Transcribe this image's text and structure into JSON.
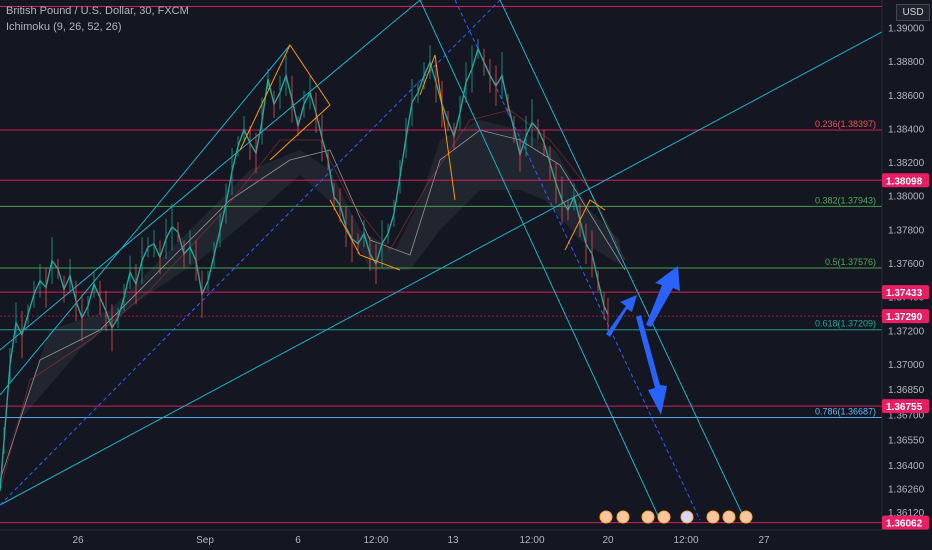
{
  "header": {
    "symbol": "British Pound / U.S. Dollar, 30, FXCM",
    "indicator": "Ichimoku (9, 26, 52, 26)",
    "currency": "USD"
  },
  "chart_data": {
    "type": "candlestick",
    "ylim": [
      1.3603,
      1.3917
    ],
    "y_ticks": [
      1.3612,
      1.3626,
      1.364,
      1.3655,
      1.367,
      1.3685,
      1.37,
      1.372,
      1.374,
      1.376,
      1.378,
      1.38,
      1.382,
      1.384,
      1.386,
      1.388,
      1.39
    ],
    "x_ticks": [
      "26",
      "Sep",
      "6",
      "12:00",
      "13",
      "12:00",
      "20",
      "12:00",
      "27"
    ],
    "horizontal_levels": [
      1.39131,
      1.38397,
      1.38098,
      1.37943,
      1.37576,
      1.37433,
      1.3729,
      1.37209,
      1.36755,
      1.36687,
      1.36062
    ],
    "price_tags": [
      {
        "label": "1.38098",
        "value": 1.38098
      },
      {
        "label": "1.37433",
        "value": 1.37433
      },
      {
        "label": "1.37290",
        "value": 1.3729
      },
      {
        "label": "1.36755",
        "value": 1.36755
      },
      {
        "label": "1.36062",
        "value": 1.36062
      }
    ],
    "fib_levels": [
      {
        "label": "0.236(1.38397)",
        "value": 1.38397
      },
      {
        "label": "0.382(1.37943)",
        "value": 1.37943
      },
      {
        "label": "0.5(1.37576)",
        "value": 1.37576
      },
      {
        "label": "0.618(1.37209)",
        "value": 1.37209
      },
      {
        "label": "0.786(1.36687)",
        "value": 1.36687
      }
    ],
    "price_path": [
      [
        0,
        1.3625
      ],
      [
        4,
        1.3655
      ],
      [
        10,
        1.37
      ],
      [
        16,
        1.3725
      ],
      [
        22,
        1.3718
      ],
      [
        28,
        1.373
      ],
      [
        34,
        1.3742
      ],
      [
        40,
        1.375
      ],
      [
        46,
        1.3746
      ],
      [
        52,
        1.3762
      ],
      [
        58,
        1.3757
      ],
      [
        64,
        1.3745
      ],
      [
        70,
        1.3753
      ],
      [
        76,
        1.3738
      ],
      [
        82,
        1.3728
      ],
      [
        88,
        1.3735
      ],
      [
        94,
        1.3748
      ],
      [
        100,
        1.374
      ],
      [
        106,
        1.3732
      ],
      [
        112,
        1.3722
      ],
      [
        118,
        1.3728
      ],
      [
        124,
        1.374
      ],
      [
        130,
        1.3755
      ],
      [
        136,
        1.3748
      ],
      [
        142,
        1.3762
      ],
      [
        148,
        1.377
      ],
      [
        154,
        1.3772
      ],
      [
        160,
        1.3764
      ],
      [
        166,
        1.3775
      ],
      [
        172,
        1.3782
      ],
      [
        178,
        1.3779
      ],
      [
        184,
        1.3766
      ],
      [
        190,
        1.377
      ],
      [
        196,
        1.3762
      ],
      [
        202,
        1.3742
      ],
      [
        208,
        1.375
      ],
      [
        214,
        1.3765
      ],
      [
        220,
        1.378
      ],
      [
        226,
        1.3796
      ],
      [
        232,
        1.3815
      ],
      [
        238,
        1.383
      ],
      [
        244,
        1.384
      ],
      [
        250,
        1.3832
      ],
      [
        256,
        1.3826
      ],
      [
        262,
        1.3845
      ],
      [
        268,
        1.387
      ],
      [
        274,
        1.3855
      ],
      [
        280,
        1.3862
      ],
      [
        286,
        1.3872
      ],
      [
        292,
        1.3858
      ],
      [
        298,
        1.3842
      ],
      [
        304,
        1.3855
      ],
      [
        310,
        1.3862
      ],
      [
        316,
        1.385
      ],
      [
        322,
        1.3835
      ],
      [
        328,
        1.3822
      ],
      [
        334,
        1.38
      ],
      [
        340,
        1.3795
      ],
      [
        346,
        1.3782
      ],
      [
        352,
        1.3775
      ],
      [
        358,
        1.3772
      ],
      [
        364,
        1.3778
      ],
      [
        370,
        1.3766
      ],
      [
        376,
        1.376
      ],
      [
        382,
        1.3772
      ],
      [
        388,
        1.3778
      ],
      [
        394,
        1.379
      ],
      [
        400,
        1.3812
      ],
      [
        406,
        1.3835
      ],
      [
        412,
        1.3856
      ],
      [
        418,
        1.3862
      ],
      [
        424,
        1.3872
      ],
      [
        430,
        1.388
      ],
      [
        436,
        1.3868
      ],
      [
        442,
        1.3855
      ],
      [
        448,
        1.3845
      ],
      [
        454,
        1.3836
      ],
      [
        460,
        1.385
      ],
      [
        466,
        1.3868
      ],
      [
        472,
        1.3876
      ],
      [
        478,
        1.3888
      ],
      [
        484,
        1.388
      ],
      [
        490,
        1.3872
      ],
      [
        496,
        1.3866
      ],
      [
        502,
        1.3872
      ],
      [
        508,
        1.3855
      ],
      [
        514,
        1.384
      ],
      [
        520,
        1.3825
      ],
      [
        526,
        1.3836
      ],
      [
        532,
        1.3844
      ],
      [
        538,
        1.384
      ],
      [
        544,
        1.3832
      ],
      [
        550,
        1.382
      ],
      [
        556,
        1.3808
      ],
      [
        562,
        1.3798
      ],
      [
        568,
        1.3792
      ],
      [
        574,
        1.38
      ],
      [
        580,
        1.3786
      ],
      [
        586,
        1.3772
      ],
      [
        592,
        1.3766
      ],
      [
        598,
        1.375
      ],
      [
        604,
        1.3735
      ],
      [
        608,
        1.373
      ]
    ]
  }
}
